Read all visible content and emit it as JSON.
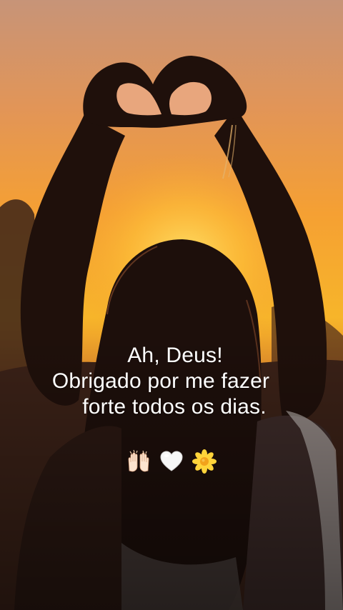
{
  "caption": {
    "line_1": "Ah, Deus!",
    "line_2": "Obrigado por me fazer",
    "line_3": "forte todos os dias."
  },
  "emojis": [
    {
      "icon": "raised-hands-icon"
    },
    {
      "icon": "white-heart-icon"
    },
    {
      "icon": "blossom-icon"
    }
  ],
  "colors": {
    "sky_top": "#c98a66",
    "sky_mid": "#f19a3a",
    "sun_glow": "#ffd43a",
    "silhouette": "#1d0f0b",
    "text": "#ffffff"
  }
}
